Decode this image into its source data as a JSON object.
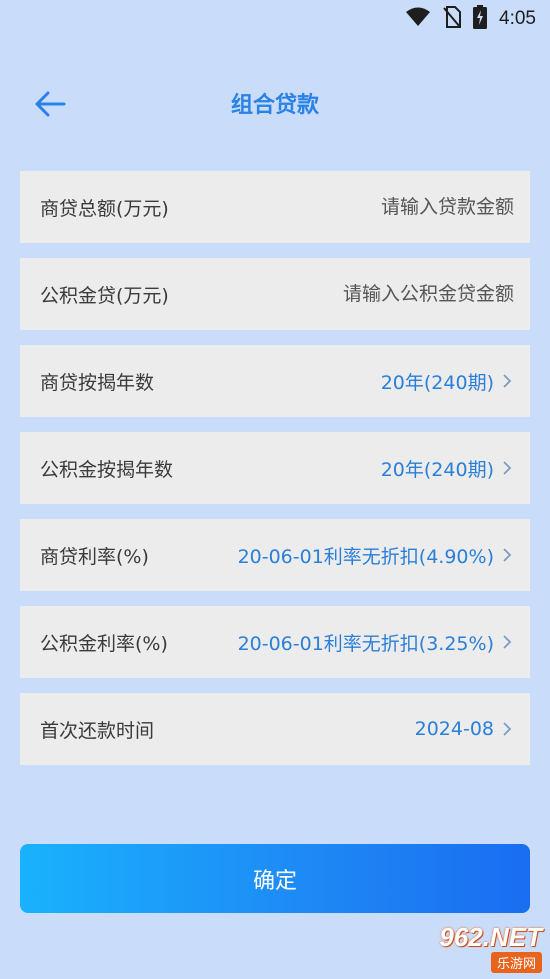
{
  "status_bar": {
    "time": "4:05",
    "icons": [
      "wifi-icon",
      "no-sim-icon",
      "battery-charging-icon"
    ]
  },
  "header": {
    "back_icon": "arrow-left-icon",
    "title": "组合贷款"
  },
  "form": {
    "rows": [
      {
        "label": "商贷总额(万元)",
        "placeholder": "请输入贷款金额",
        "value": ""
      },
      {
        "label": "公积金贷(万元)",
        "placeholder": "请输入公积金贷金额",
        "value": ""
      },
      {
        "label": "商贷按揭年数",
        "value": "20年(240期)"
      },
      {
        "label": "公积金按揭年数",
        "value": "20年(240期)"
      },
      {
        "label": "商贷利率(%)",
        "value": "20-06-01利率无折扣(4.90%)"
      },
      {
        "label": "公积金利率(%)",
        "value": "20-06-01利率无折扣(3.25%)"
      },
      {
        "label": "首次还款时间",
        "value": "2024-08"
      }
    ]
  },
  "confirm_label": "确定",
  "watermark": {
    "brand": "962.NET",
    "sub": "乐游网"
  },
  "colors": {
    "background": "#c9ddfb",
    "accent": "#2a82e4",
    "row_bg": "#ececec",
    "button_gradient_start": "#19b2fd",
    "button_gradient_end": "#1a6df1"
  }
}
